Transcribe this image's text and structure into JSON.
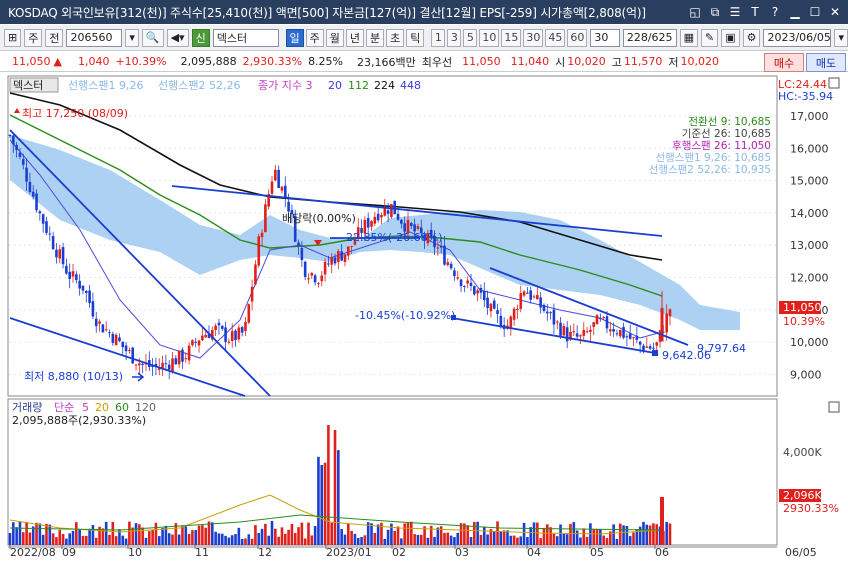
{
  "window": {
    "title": "KOSDAQ 외국인보유[312(천)] 주식수[25,410(천)] 액면[500] 자본금[127(억)] 결산[12월] EPS[-259] 시가총액[2,808(억)]",
    "controls": [
      "◱",
      "⧉",
      "☰",
      "T",
      "?",
      "▁",
      "☐",
      "✕"
    ]
  },
  "toolbar": {
    "kind": "주",
    "mode": "전",
    "code": "206560",
    "stock_badge": "신",
    "stock_name": "덱스터",
    "periods": [
      "일",
      "주",
      "월",
      "년",
      "분",
      "초",
      "틱"
    ],
    "intervals": [
      "1",
      "3",
      "5",
      "10",
      "15",
      "30",
      "45",
      "60"
    ],
    "count_select": "30",
    "range": "228/625",
    "date": "2023/06/05"
  },
  "quote": {
    "price": "11,050",
    "change": "1,040",
    "change_pct": "+10.39%",
    "volume": "2,095,888",
    "volume_ratio": "2,930.33%",
    "turnover": "8.25%",
    "amount": "23,166백만",
    "best_ask_label": "최우선",
    "best_ask": "11,050",
    "best_bid": "11,040",
    "open_label": "시",
    "open": "10,020",
    "high_label": "고",
    "high": "11,570",
    "low_label": "저",
    "low": "10,020",
    "buy_label": "매수",
    "sell_label": "매도"
  },
  "price_chart": {
    "legend": {
      "name": "덱스터",
      "lead1": "선행스팬1 9,26",
      "lead2": "선행스팬2 52,26",
      "ma_label": "종가 지수 3",
      "ma_periods": [
        "20",
        "112",
        "224",
        "448"
      ]
    },
    "lc": "LC:24.44",
    "hc": "HC:-35.94",
    "ichimoku": [
      "전환선 9: 10,685",
      "기준선 26: 10,685",
      "후행스팬 26: 11,050",
      "선행스팬1 9,26: 10,685",
      "선행스팬2 52,26: 10,935"
    ],
    "max_label": "최고 17,250 (08/09)",
    "min_label": "최저 8,880 (10/13)",
    "annotations": {
      "ex_div": "배당락(0.00%)",
      "pct1": "-22.85%(-26.68%)",
      "pct2": "-10.45%(-10.92%)",
      "trend_lo": "9,642.06",
      "trend_hi": "9,797.64"
    },
    "y_ticks": [
      "17,000",
      "16,000",
      "15,000",
      "14,000",
      "13,000",
      "12,000",
      "11,000",
      "10,000",
      "9,000"
    ],
    "cur_price": "11,050",
    "cur_pct": "10.39%"
  },
  "volume_chart": {
    "legend": {
      "name": "거래량",
      "simple": "단순",
      "periods": [
        "5",
        "20",
        "60",
        "120"
      ]
    },
    "info": "2,095,888주(2,930.33%)",
    "y_tick": "4,000K",
    "cur_vol": "2,096K",
    "cur_pct": "2930.33%"
  },
  "x_axis": {
    "labels": [
      "2022/08",
      "09",
      "10",
      "11",
      "12",
      "2023/01",
      "02",
      "03",
      "04",
      "05",
      "06"
    ],
    "right": "06/05"
  },
  "colors": {
    "up": "#e0201c",
    "down": "#1a3fd0",
    "cloud": "#9ec9f0",
    "ma20": "#4a4adc",
    "ma112": "#2a8c1a",
    "ma224": "#111111"
  },
  "chart_data": {
    "type": "candlestick",
    "series_label": "덱스터",
    "x": [
      "2022/08",
      "09",
      "10",
      "11",
      "12",
      "2023/01",
      "02",
      "03",
      "04",
      "05",
      "06"
    ],
    "close_path": [
      16400,
      15300,
      14000,
      13000,
      12100,
      11700,
      10600,
      10200,
      9700,
      9300,
      9200,
      9400,
      9600,
      10200,
      10400,
      10100,
      10300,
      13200,
      15400,
      14200,
      12300,
      12000,
      12600,
      12800,
      13500,
      14000,
      14200,
      13600,
      13300,
      13000,
      12400,
      11800,
      11500,
      10800,
      10500,
      11700,
      11200,
      10700,
      10200,
      10100,
      10600,
      10500,
      10200,
      9900,
      9800,
      11050
    ],
    "ylim": [
      8500,
      17500
    ],
    "high": 17250,
    "low": 8880,
    "last": 11050
  }
}
